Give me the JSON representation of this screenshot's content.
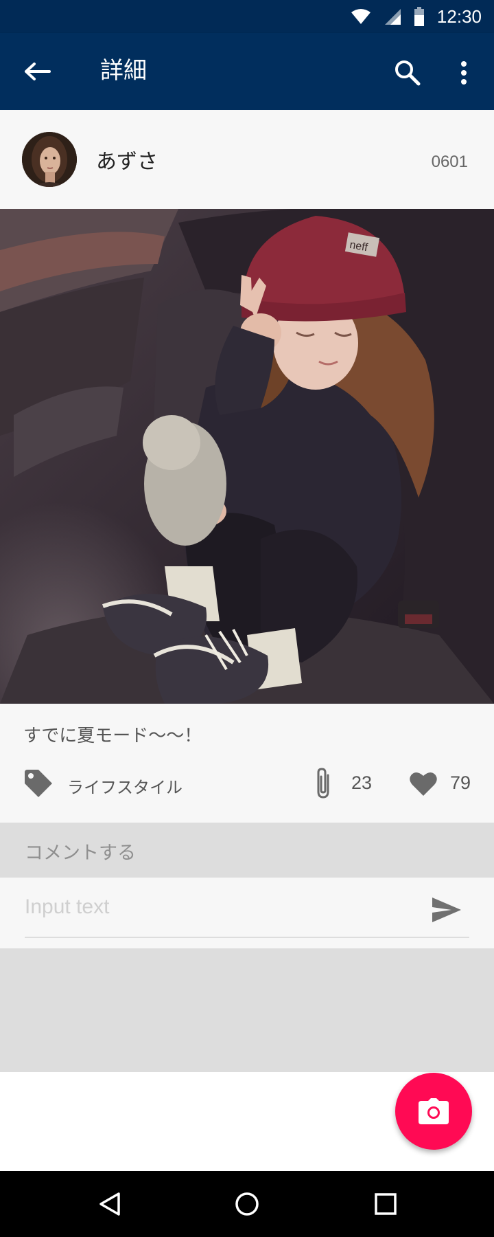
{
  "status_bar": {
    "time": "12:30",
    "icons": [
      "wifi-icon",
      "signal-icon",
      "battery-icon"
    ]
  },
  "app_bar": {
    "title": "詳細",
    "icons": [
      "back-arrow-icon",
      "search-icon",
      "more-vert-icon"
    ]
  },
  "post": {
    "username": "あずさ",
    "user_id": "0601",
    "caption": "すでに夏モード〜〜！",
    "category": "ライフスタイル",
    "clip_count": "23",
    "like_count": "79",
    "image_hat_text": "neff"
  },
  "comment": {
    "header": "コメントする",
    "input_placeholder": "Input text",
    "input_value": ""
  },
  "fab": {
    "icon": "camera-icon"
  },
  "nav_bar": {
    "icons": [
      "back-triangle-icon",
      "home-circle-icon",
      "recents-square-icon"
    ]
  },
  "colors": {
    "app_bar": "#012e5d",
    "status_bar": "#012a56",
    "fab": "#ff0a54",
    "comment_header_bg": "#dddddd",
    "card_bg": "#f7f7f7"
  }
}
